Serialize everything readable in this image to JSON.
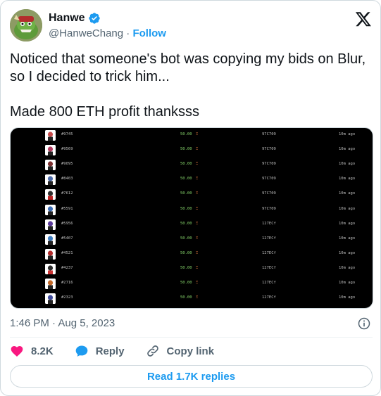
{
  "author": {
    "name": "Hanwe",
    "handle": "@HanweChang",
    "separator": "·",
    "follow_label": "Follow",
    "verified_icon": "verified-badge-icon",
    "avatar": "avatar-image"
  },
  "tweet": {
    "text": "Noticed that someone's bot was copying my bids on Blur,\nso I decided to trick him...\n\nMade 800 ETH profit thanksss",
    "timestamp": "1:46 PM · Aug 5, 2023"
  },
  "media": {
    "rows": [
      {
        "id": "#9745",
        "price": "50.00",
        "unit": "Ξ",
        "addr": "97C709",
        "ago": "10m ago"
      },
      {
        "id": "#9569",
        "price": "50.00",
        "unit": "Ξ",
        "addr": "97C709",
        "ago": "10m ago"
      },
      {
        "id": "#9095",
        "price": "50.00",
        "unit": "Ξ",
        "addr": "97C709",
        "ago": "10m ago"
      },
      {
        "id": "#8403",
        "price": "50.00",
        "unit": "Ξ",
        "addr": "97C709",
        "ago": "10m ago"
      },
      {
        "id": "#7612",
        "price": "50.00",
        "unit": "Ξ",
        "addr": "97C709",
        "ago": "10m ago"
      },
      {
        "id": "#5591",
        "price": "50.00",
        "unit": "Ξ",
        "addr": "97C709",
        "ago": "10m ago"
      },
      {
        "id": "#5956",
        "price": "50.00",
        "unit": "Ξ",
        "addr": "127ECf",
        "ago": "10m ago"
      },
      {
        "id": "#5407",
        "price": "50.00",
        "unit": "Ξ",
        "addr": "127ECf",
        "ago": "10m ago"
      },
      {
        "id": "#4521",
        "price": "50.00",
        "unit": "Ξ",
        "addr": "127ECf",
        "ago": "10m ago"
      },
      {
        "id": "#4237",
        "price": "50.00",
        "unit": "Ξ",
        "addr": "127ECf",
        "ago": "10m ago"
      },
      {
        "id": "#2716",
        "price": "50.00",
        "unit": "Ξ",
        "addr": "127ECf",
        "ago": "10m ago"
      },
      {
        "id": "#2323",
        "price": "50.00",
        "unit": "Ξ",
        "addr": "127ECf",
        "ago": "10m ago"
      }
    ]
  },
  "actions": {
    "like_count": "8.2K",
    "reply_label": "Reply",
    "copy_label": "Copy link",
    "read_replies_label": "Read 1.7K replies"
  },
  "colors": {
    "accent": "#1d9bf0",
    "like": "#f91880",
    "muted": "#536471"
  }
}
